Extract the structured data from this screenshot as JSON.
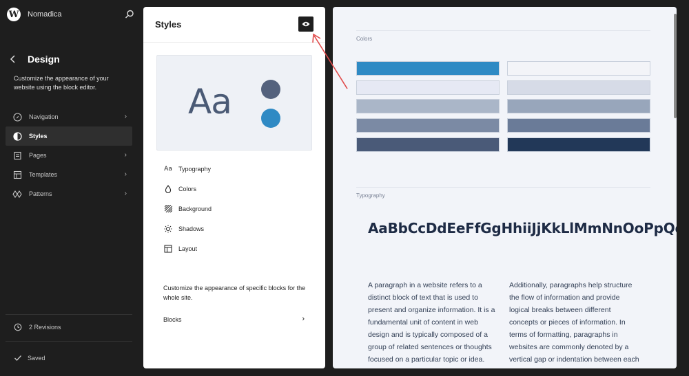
{
  "sidebar": {
    "site_name": "Nomadica",
    "title": "Design",
    "description": "Customize the appearance of your website using the block editor.",
    "items": [
      {
        "label": "Navigation",
        "icon": "navigation-icon"
      },
      {
        "label": "Styles",
        "icon": "styles-icon",
        "active": true
      },
      {
        "label": "Pages",
        "icon": "pages-icon"
      },
      {
        "label": "Templates",
        "icon": "templates-icon"
      },
      {
        "label": "Patterns",
        "icon": "patterns-icon"
      }
    ],
    "revisions": "2 Revisions",
    "saved": "Saved"
  },
  "styles_panel": {
    "title": "Styles",
    "preview_text": "Aa",
    "menu": [
      {
        "label": "Typography",
        "icon": "typography-icon",
        "glyph": "Aa"
      },
      {
        "label": "Colors",
        "icon": "droplet-icon"
      },
      {
        "label": "Background",
        "icon": "background-icon"
      },
      {
        "label": "Shadows",
        "icon": "shadows-icon"
      },
      {
        "label": "Layout",
        "icon": "layout-icon"
      }
    ],
    "blocks_description": "Customize the appearance of specific blocks for the whole site.",
    "blocks_label": "Blocks"
  },
  "canvas": {
    "colors_label": "Colors",
    "typography_label": "Typography",
    "typography_sample": "AaBbCcDdEeFfGgHhiiJjKkLlMmNnOoPpQqKrRrssTtUuVVWwXxxYyZzOI23356789X{(…)},2!*&:/A@HELFO™",
    "paragraph_left": "A paragraph in a website refers to a distinct block of text that is used to present and organize information. It is a fundamental unit of content in web design and is typically composed of a group of related sentences or thoughts focused on a particular topic or idea. Paragraphs play a",
    "paragraph_right": "Additionally, paragraphs help structure the flow of information and provide logical breaks between different concepts or pieces of information. In terms of formatting, paragraphs in websites are commonly denoted by a vertical gap or indentation between each block of"
  },
  "colors": {
    "accent": "#2f8ac4",
    "swatches_left": [
      "#2f8ac4",
      "#e6e9f4",
      "#aab6c8",
      "#7b8aa4",
      "#4a5a78"
    ],
    "swatches_right": [
      "#f3f4f8",
      "#d6dbe7",
      "#98a6bb",
      "#6a7b98",
      "#223858"
    ],
    "annotation_arrow": "#e04a4a"
  }
}
